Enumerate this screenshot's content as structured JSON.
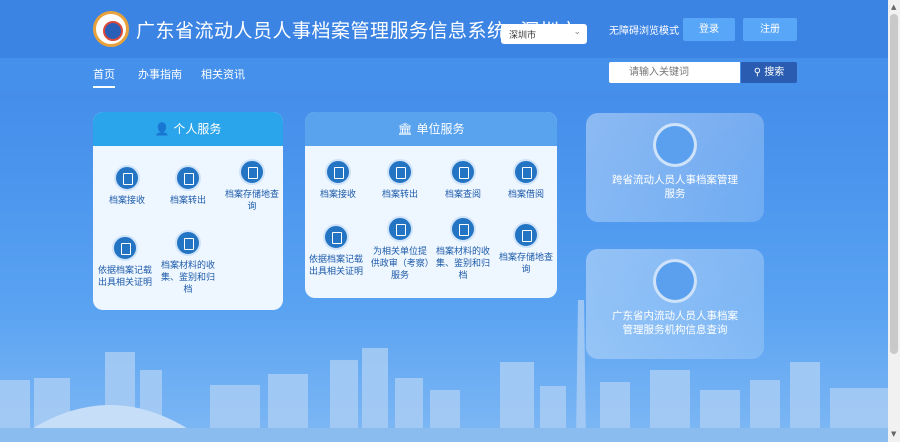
{
  "header": {
    "title": "广东省流动人员人事档案管理服务信息系统- 深圳市",
    "city_select": "深圳市",
    "access_mode": "无障碍浏览模式",
    "login": "登录",
    "register": "注册"
  },
  "nav": {
    "items": [
      "首页",
      "办事指南",
      "相关资讯"
    ],
    "search_placeholder": "请输入关键词",
    "search_button": "搜索"
  },
  "personal": {
    "title": "个人服务",
    "items": [
      "档案接收",
      "档案转出",
      "档案存储地查询",
      "依据档案记载出具相关证明",
      "档案材料的收集、鉴别和归档"
    ]
  },
  "unit": {
    "title": "单位服务",
    "items": [
      "档案接收",
      "档案转出",
      "档案查阅",
      "档案借阅",
      "依据档案记载出具相关证明",
      "为相关单位提供政审（考察）服务",
      "档案材料的收集、鉴别和归档",
      "档案存储地查询"
    ]
  },
  "cards": [
    {
      "text": "跨省流动人员人事档案管理服务"
    },
    {
      "text": "广东省内流动人员人事档案管理服务机构信息查询"
    }
  ],
  "colors": {
    "header": "#3c84e4",
    "accent": "#2aa4ea",
    "search_btn": "#2a5db2"
  }
}
